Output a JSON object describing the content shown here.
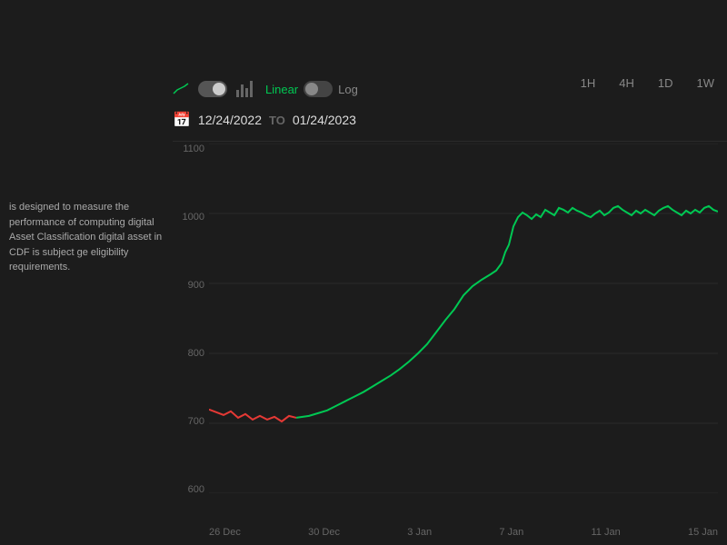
{
  "sidebar": {
    "description": "is designed to measure the performance of computing digital Asset Classification digital asset in CDF is subject ge eligibility requirements."
  },
  "toolbar": {
    "linear_label": "Linear",
    "log_label": "Log",
    "toggle_active": true
  },
  "date_range": {
    "from": "12/24/2022",
    "to_label": "TO",
    "to": "01/24/2023"
  },
  "time_ranges": [
    "1H",
    "4H",
    "1D",
    "1W"
  ],
  "y_axis": [
    "1100",
    "1000",
    "900",
    "800",
    "700",
    "600"
  ],
  "x_axis": [
    "26 Dec",
    "30 Dec",
    "3 Jan",
    "7 Jan",
    "11 Jan",
    "15 Jan"
  ],
  "colors": {
    "green": "#00c853",
    "red": "#e53935",
    "background": "#1c1c1c",
    "grid": "#2a2a2a"
  }
}
